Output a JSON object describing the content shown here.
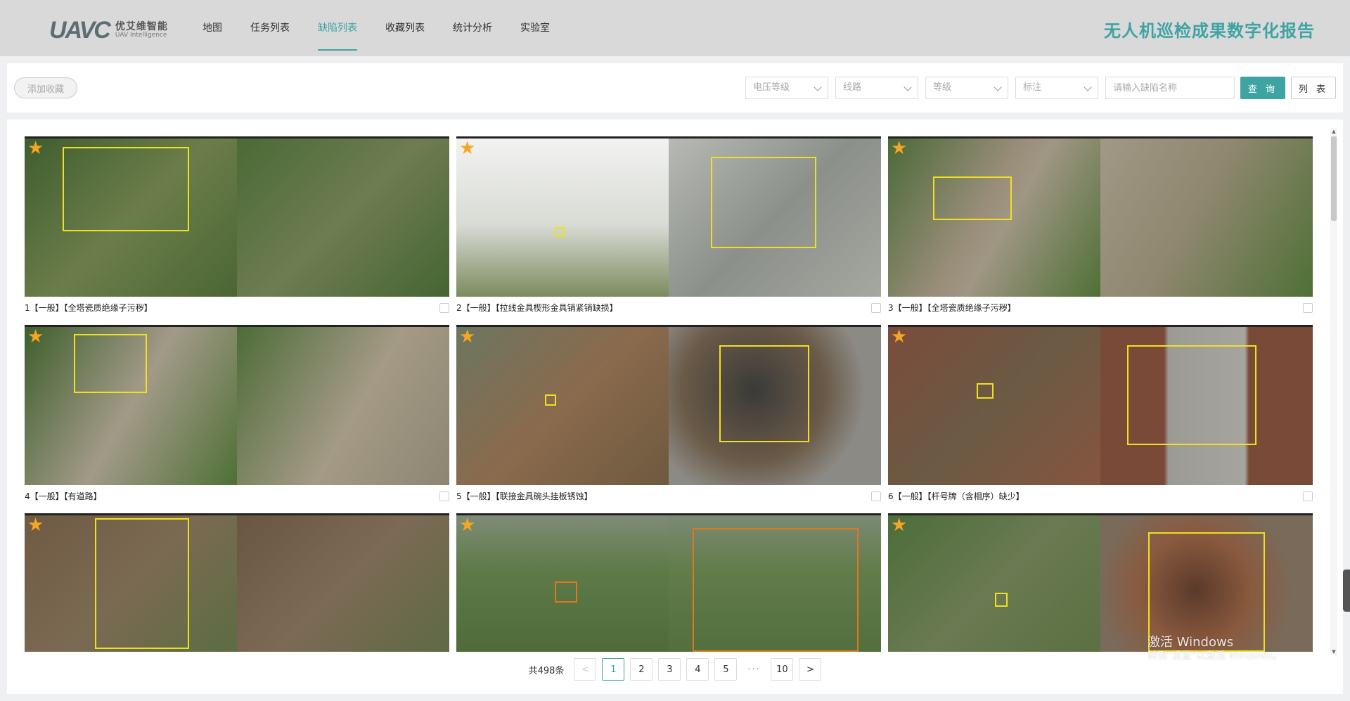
{
  "header": {
    "logo_mark": "UAVC",
    "logo_cn": "优艾维智能",
    "logo_en": "UAV Intelligence",
    "nav": [
      "地图",
      "任务列表",
      "缺陷列表",
      "收藏列表",
      "统计分析",
      "实验室"
    ],
    "active_nav": "缺陷列表",
    "title": "无人机巡检成果数字化报告"
  },
  "toolbar": {
    "add_favorite": "添加收藏",
    "filters": [
      {
        "placeholder": "电压等级"
      },
      {
        "placeholder": "线路"
      },
      {
        "placeholder": "等级"
      },
      {
        "placeholder": "标注"
      }
    ],
    "search_placeholder": "请输入缺陷名称",
    "query_label": "查 询",
    "list_label": "列 表"
  },
  "cards": [
    {
      "caption": "1【一般】【全塔瓷质绝缘子污秽】",
      "left_bg": "#4d6b3a",
      "right_bg": "#52703c",
      "box_color": "yellow"
    },
    {
      "caption": "2【一般】【拉线金具楔形金具销紧销缺损】",
      "left_bg": "#c9ccc8",
      "right_bg": "#9ea29b",
      "box_color": "yellow"
    },
    {
      "caption": "3【一般】【全塔瓷质绝缘子污秽】",
      "left_bg": "#6a7a50",
      "right_bg": "#7d8064",
      "box_color": "yellow"
    },
    {
      "caption": "4【一般】【有道路】",
      "left_bg": "#5a7342",
      "right_bg": "#8a8672",
      "box_color": "yellow"
    },
    {
      "caption": "5【一般】【联接金具碗头挂板锈蚀】",
      "left_bg": "#6f6048",
      "right_bg": "#5c4a3c",
      "box_color": "yellow"
    },
    {
      "caption": "6【一般】【杆号牌（含相序）缺少】",
      "left_bg": "#7a4a38",
      "right_bg": "#7c5442",
      "box_color": "yellow"
    },
    {
      "caption": "",
      "left_bg": "#6f5a44",
      "right_bg": "#66553f",
      "box_color": "yellow"
    },
    {
      "caption": "",
      "left_bg": "#5c7a4c",
      "right_bg": "#5f7b46",
      "box_color": "orange"
    },
    {
      "caption": "",
      "left_bg": "#55703f",
      "right_bg": "#6e5446",
      "box_color": "yellow"
    }
  ],
  "pagination": {
    "total": "共498条",
    "prev": "<",
    "pages": [
      "1",
      "2",
      "3",
      "4",
      "5"
    ],
    "dots": "···",
    "last": "10",
    "next": ">",
    "current": "1"
  },
  "watermark": {
    "line1": "激活 Windows",
    "line2": "转到\"设置\"以激活 Windows。"
  },
  "colors": {
    "accent": "#3ea3a3",
    "star": "#f5a623",
    "box_yellow": "#f0e020",
    "box_orange": "#e07820"
  }
}
